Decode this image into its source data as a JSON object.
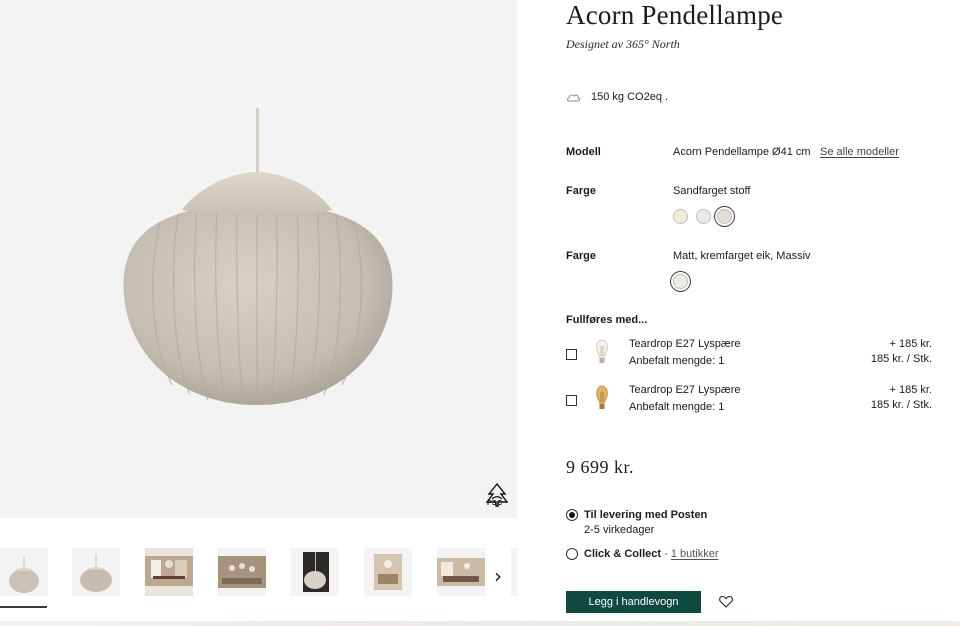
{
  "product": {
    "title": "Acorn Pendellampe",
    "designer": "Designet av 365° North",
    "co2": "150 kg CO2eq ."
  },
  "options": {
    "model_label": "Modell",
    "model_value": "Acorn Pendellampe Ø41 cm",
    "see_all": "Se alle modeller",
    "color1_label": "Farge",
    "color1_value": "Sandfarget stoff",
    "color1_swatches": [
      "#f3ecd9",
      "#e7e9ee",
      "#e4ddd1"
    ],
    "color2_label": "Farge",
    "color2_value": "Matt, kremfarget eik, Massiv",
    "color2_swatches": [
      "#efece6"
    ]
  },
  "addons": {
    "heading": "Fullføres med...",
    "items": [
      {
        "name": "Teardrop E27 Lyspære",
        "qty": "Anbefalt mengde: 1",
        "price": "+ 185 kr.",
        "unit": "185 kr. / Stk.",
        "icon": "clear-bulb-icon"
      },
      {
        "name": "Teardrop E27 Lyspære",
        "qty": "Anbefalt mengde: 1",
        "price": "+ 185 kr.",
        "unit": "185 kr. / Stk.",
        "icon": "amber-bulb-icon"
      }
    ]
  },
  "price": "9 699 kr.",
  "delivery": {
    "post_title": "Til levering med Posten",
    "post_sub": "2-5 virkedager",
    "collect_title": "Click & Collect",
    "collect_sep": " - ",
    "collect_link": "1 butikker"
  },
  "cart_button": "Legg i handlevogn",
  "gallery": {
    "fsc": "FSC",
    "accent_colors": [
      "#cbc4b6",
      "#0e4a3d"
    ]
  }
}
